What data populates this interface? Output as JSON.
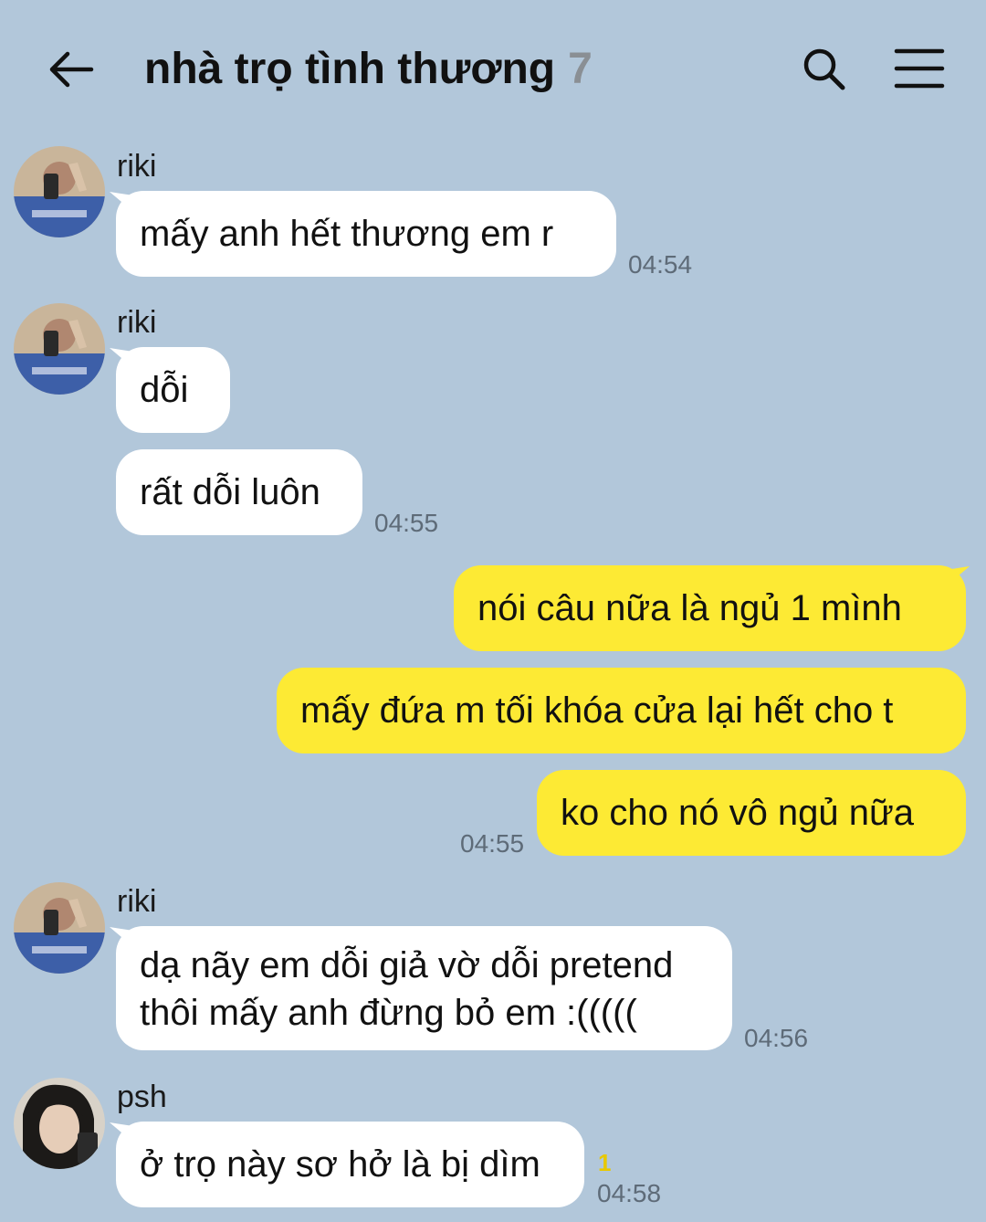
{
  "header": {
    "title": "nhà trọ tình thương",
    "member_count": "7",
    "icons": {
      "back": "arrow-left-icon",
      "search": "search-icon",
      "menu": "hamburger-menu-icon"
    }
  },
  "colors": {
    "background": "#b2c7da",
    "incoming_bubble": "#ffffff",
    "outgoing_bubble": "#fdea34",
    "timestamp": "#5e6b78",
    "unread_count": "#e8c800"
  },
  "messages": [
    {
      "sender": "riki",
      "text": "mấy anh hết thương em r",
      "time": "04:54"
    },
    {
      "sender": "riki",
      "text": "dỗi"
    },
    {
      "text": "rất dỗi luôn",
      "time": "04:55"
    },
    {
      "outgoing": true,
      "text": "nói câu nữa là ngủ 1 mình"
    },
    {
      "outgoing": true,
      "text": "mấy đứa m tối khóa cửa lại hết cho t"
    },
    {
      "outgoing": true,
      "text": "ko cho nó vô ngủ nữa",
      "time": "04:55"
    },
    {
      "sender": "riki",
      "lines": [
        "dạ nãy em dỗi giả vờ dỗi pretend",
        "thôi mấy anh đừng bỏ em :((((("
      ],
      "time": "04:56"
    },
    {
      "sender": "psh",
      "text": "ở trọ này sơ hở là bị dìm",
      "unread": "1",
      "time": "04:58"
    }
  ]
}
